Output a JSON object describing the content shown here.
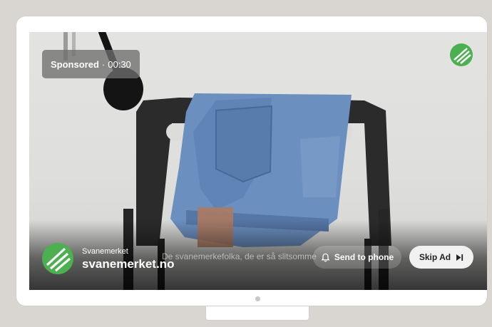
{
  "ad": {
    "sponsored_label": "Sponsored",
    "separator": "·",
    "time_remaining": "00:30",
    "advertiser_name": "Svanemerket",
    "advertiser_domain": "svanemerket.no",
    "caption": "De svanemerkefolka, de er så slitsomme",
    "send_to_phone_label": "Send to phone",
    "skip_ad_label": "Skip Ad"
  },
  "icons": {
    "corner": "nordic-swan-ecolabel-icon",
    "logo": "nordic-swan-ecolabel-logo",
    "send_to_phone": "bell-icon",
    "skip": "skip-next-icon"
  },
  "colors": {
    "ecolabel_green": "#4caf50",
    "frame_background": "#d9d6d1"
  }
}
